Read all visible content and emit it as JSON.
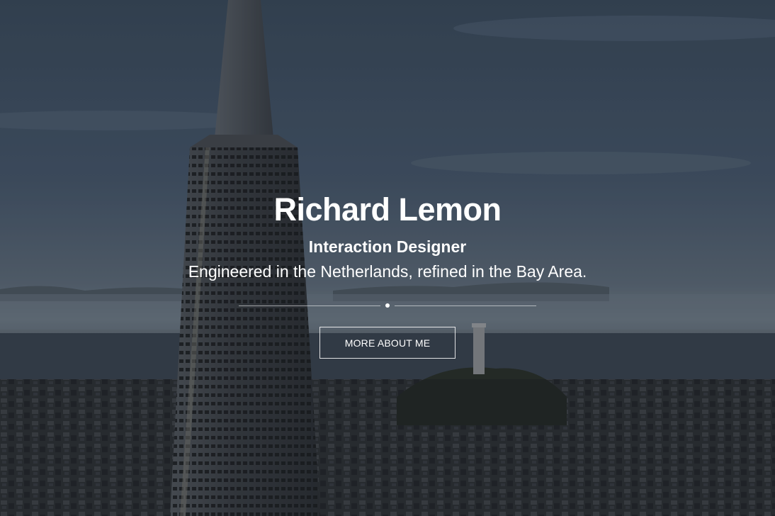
{
  "hero": {
    "name": "Richard Lemon",
    "role": "Interaction Designer",
    "tagline": "Engineered in the Netherlands, refined in the Bay Area.",
    "cta_label": "MORE ABOUT ME"
  },
  "colors": {
    "text": "#ffffff",
    "sky": "#3d4d5e",
    "fog": "#6b7985",
    "city": "#2a2b2e"
  }
}
